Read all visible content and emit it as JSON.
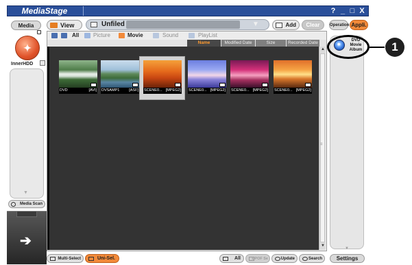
{
  "titlebar": {
    "title": "MediaStage",
    "buttons": [
      "?",
      "_",
      "□",
      "X"
    ]
  },
  "header": {
    "media_label": "Media",
    "view_all_label": "View All",
    "folder_label": "Unfiled",
    "add_label": "Add",
    "clear_label": "Clear",
    "operation_label": "Operation",
    "appli_label": "Appli."
  },
  "sidebar": {
    "device_label": "InnerHDD",
    "media_scan_label": "Media Scan",
    "bottom_arrow": "➔"
  },
  "filters": [
    {
      "label": "All",
      "active": true
    },
    {
      "label": "Picture",
      "active": false
    },
    {
      "label": "Movie",
      "active": true
    },
    {
      "label": "Sound",
      "active": false
    },
    {
      "label": "PlayList",
      "active": false
    }
  ],
  "sort_tabs": [
    {
      "label": "Name",
      "active": true
    },
    {
      "label": "Modified Date",
      "active": false
    },
    {
      "label": "Size",
      "active": false
    },
    {
      "label": "Recorded Date",
      "active": false
    }
  ],
  "thumbnails": [
    {
      "name": "DVD",
      "format": "[AVI]",
      "selected": false
    },
    {
      "name": "DVSAMP1",
      "format": "[ASF]",
      "selected": false
    },
    {
      "name": "SCENE0...",
      "format": "[MPEG2]",
      "selected": true
    },
    {
      "name": "SCENE0...",
      "format": "[MPEG2]",
      "selected": false
    },
    {
      "name": "SCENE0...",
      "format": "[MPEG2]",
      "selected": false
    },
    {
      "name": "SCENE0...",
      "format": "[MPEG2]",
      "selected": false
    }
  ],
  "right_panel": {
    "album_label_1": "DVD",
    "album_label_2": "Movie",
    "album_label_3": "Album",
    "callout_number": "1",
    "settings_label": "Settings"
  },
  "bottom": {
    "multi_select_label": "Multi-Select",
    "uni_sel_label": "Uni-Sel.",
    "all_label": "All",
    "dpof_label": "DPOF Se",
    "update_label": "Update",
    "search_label": "Search"
  },
  "colors": {
    "title_bar": "#2a4f9a",
    "accent_orange": "#f28a3a",
    "content_bg": "#333333",
    "sort_active_text": "#ff9a2e"
  }
}
